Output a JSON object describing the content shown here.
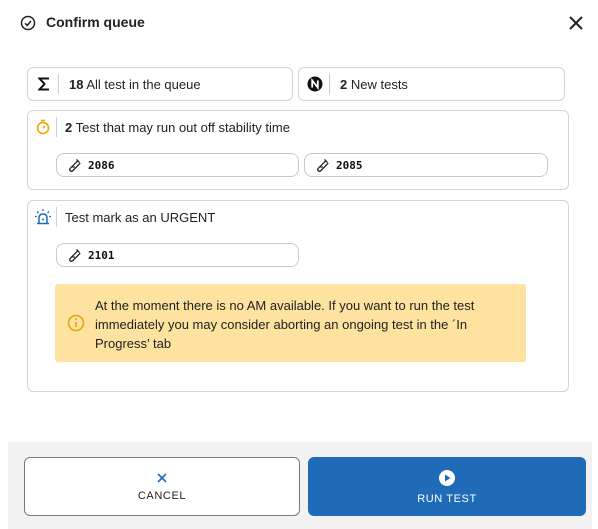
{
  "dialog": {
    "title": "Confirm queue",
    "title_icon": "check-circle-icon",
    "close_icon": "close-icon"
  },
  "summary": {
    "all": {
      "icon": "sigma-icon",
      "count": "18",
      "label": "All test in the queue"
    },
    "new": {
      "icon": "new-badge-icon",
      "count": "2",
      "label": "New tests"
    }
  },
  "stability": {
    "icon": "stopwatch-icon",
    "count": "2",
    "label": "Test that may run out off stability time",
    "tests": [
      "2086",
      "2085"
    ]
  },
  "urgent": {
    "icon": "siren-icon",
    "label": "Test mark as an URGENT",
    "tests": [
      "2101"
    ]
  },
  "warning": {
    "icon": "info-icon",
    "text": "At the moment there is no AM available. If you want to run the test immediately you may consider aborting an ongoing test in the ´In Progress’ tab",
    "color": "#fde2a0"
  },
  "buttons": {
    "cancel": {
      "label": "CANCEL",
      "icon": "close-icon"
    },
    "run": {
      "label": "RUN TEST",
      "icon": "play-circle-icon",
      "color": "#1f6bb8"
    }
  },
  "test_icon": "test-tube-icon"
}
